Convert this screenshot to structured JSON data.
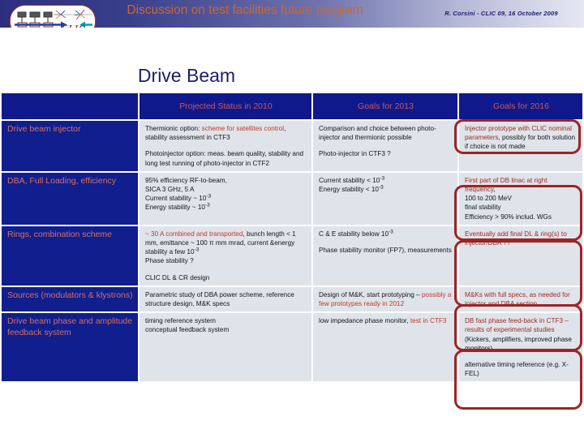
{
  "header": {
    "title": "Discussion on test facilities future program",
    "meta": "R. Corsini - CLIC 09, 16 October 2009",
    "logo_text": "CLIC",
    "accent_color": "#cc6633",
    "band_color": "#2b2f7e"
  },
  "slide": {
    "title": "Drive Beam"
  },
  "table": {
    "columns": [
      "",
      "Projected Status in 2010",
      "Goals for 2013",
      "Goals for 2016"
    ],
    "rows": [
      {
        "label": "Drive beam injector",
        "status_2010_a1": "Thermionic option: ",
        "status_2010_a2": "scheme for satellites control",
        "status_2010_a3": ", stability assessment in CTF3",
        "status_2010_b": "Photoinjector option: meas. beam quality, stability and long test running of photo-injector in CTF2",
        "goals_2013_a": "Comparison and choice between photo-injector and thermionic possible",
        "goals_2013_b": "Photo-injector in CTF3 ?",
        "goals_2016_a": "Injector prototype with CLIC nominal parameters",
        "goals_2016_b": ", possibly for both solution if choice is not made"
      },
      {
        "label": "DBA, Full Loading, efficiency",
        "status_2010_l1": "95% efficiency RF-to-beam,",
        "status_2010_l2": "SICA 3 GHz, 5 A",
        "status_2010_l3": "Current stability ~ 10",
        "status_2010_l3sup": "-3",
        "status_2010_l4": "Energy stability ~ 10",
        "status_2010_l4sup": "-3",
        "goals_2013_l1": "Current stability < 10",
        "goals_2013_l1sup": "-3",
        "goals_2013_l2": "Energy stability < 10",
        "goals_2013_l2sup": "-3",
        "goals_2016_a": "First part of DB linac at right frequency",
        "goals_2016_b": ",",
        "goals_2016_l2": "100 to 200 MeV",
        "goals_2016_l3": "final stability",
        "goals_2016_l4": "Efficiency > 90% includ. WGs"
      },
      {
        "label": "Rings, combination scheme",
        "status_2010_red": "~ 30 A combined and transported",
        "status_2010_rest": ", bunch length < 1 mm, emittance ~ 100 π mm mrad, current &energy stability a few 10",
        "status_2010_sup": "-3",
        "status_2010_l4": "Phase stability ?",
        "status_2010_l5": "CLIC DL & CR design",
        "goals_2013_l1": "C & E stability below 10",
        "goals_2013_l1sup": "-3",
        "goals_2013_l2": "Phase stability monitor (FP7), measurements",
        "goals_2016_a": "Eventually add final DL & ring(s) to injector/DBA ??"
      },
      {
        "label": "Sources (modulators & klystrons)",
        "status_2010_a": "Parametric study of DBA power scheme, reference structure design, M&K specs",
        "goals_2013_a": "Design of M&K, start prototyping – ",
        "goals_2013_red": "possibly a few prototypes ready in 2012",
        "goals_2016_a": "M&Ks with full specs, as needed for injector and DBA section."
      },
      {
        "label": "Drive beam phase and amplitude feedback system",
        "status_2010_l1": "timing reference system",
        "status_2010_l2": "conceptual feedback system",
        "goals_2013_a": "low impedance phase monitor, ",
        "goals_2013_red": "test in CTF3",
        "goals_2016_red": "DB fast phase feed-back in CTF3 – results of experimental studies",
        "goals_2016_blk": " (Kickers, amplifiers, improved phase monitors)",
        "goals_2016_b": "alternative timing reference (e.g. X-FEL)"
      }
    ]
  }
}
